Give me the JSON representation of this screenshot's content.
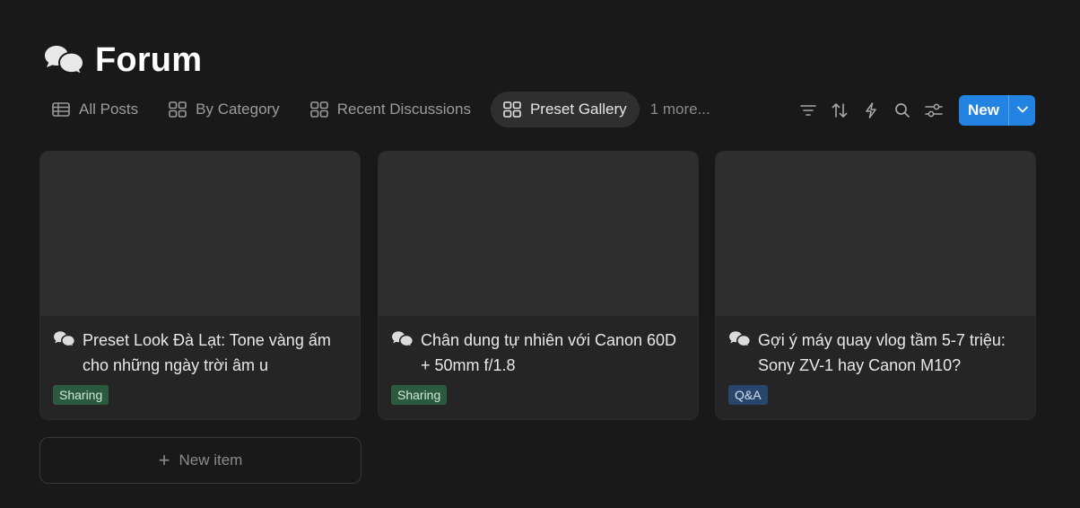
{
  "page": {
    "title": "Forum",
    "title_icon": "speech-bubbles-icon"
  },
  "tabs": [
    {
      "label": "All Posts",
      "icon": "table-icon",
      "active": false
    },
    {
      "label": "By Category",
      "icon": "gallery-icon",
      "active": false
    },
    {
      "label": "Recent Discussions",
      "icon": "gallery-icon",
      "active": false
    },
    {
      "label": "Preset Gallery",
      "icon": "gallery-icon",
      "active": true
    },
    {
      "label": "1 more...",
      "icon": "",
      "active": false
    }
  ],
  "toolbar": {
    "icons": [
      "filter-icon",
      "sort-icon",
      "automation-bolt-icon",
      "search-icon",
      "settings-sliders-icon"
    ],
    "new_label": "New",
    "accent_color": "#2383e2"
  },
  "cards": [
    {
      "title": "Preset Look Đà Lạt: Tone vàng ấm cho những ngày trời âm u",
      "tag": "Sharing",
      "tag_color": "#2b5a3f"
    },
    {
      "title": "Chân dung tự nhiên với Canon 60D + 50mm f/1.8",
      "tag": "Sharing",
      "tag_color": "#2b5a3f"
    },
    {
      "title": "Gợi ý máy quay vlog tầm 5-7 triệu: Sony ZV-1 hay Canon M10?",
      "tag": "Q&A",
      "tag_color": "#28456c"
    }
  ],
  "new_item": {
    "label": "New item"
  }
}
